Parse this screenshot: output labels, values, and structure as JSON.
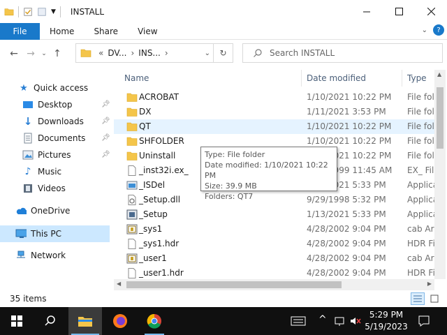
{
  "window": {
    "title": "INSTALL",
    "minimize_icon": "minimize-icon",
    "maximize_icon": "maximize-icon",
    "close_icon": "close-icon"
  },
  "ribbon": {
    "tabs": [
      "File",
      "Home",
      "Share",
      "View"
    ],
    "help_glyph": "?"
  },
  "address": {
    "overflow": "«",
    "crumbs": [
      "DV...",
      "INS..."
    ],
    "sep": "›",
    "search_placeholder": "Search INSTALL"
  },
  "nav": {
    "quick_access": "Quick access",
    "items": [
      {
        "label": "Desktop",
        "pinned": true
      },
      {
        "label": "Downloads",
        "pinned": true
      },
      {
        "label": "Documents",
        "pinned": true
      },
      {
        "label": "Pictures",
        "pinned": true
      },
      {
        "label": "Music",
        "pinned": false
      },
      {
        "label": "Videos",
        "pinned": false
      }
    ],
    "onedrive": "OneDrive",
    "this_pc": "This PC",
    "network": "Network"
  },
  "columns": {
    "name": "Name",
    "date": "Date modified",
    "type": "Type"
  },
  "files": [
    {
      "name": "ACROBAT",
      "date": "1/10/2021 10:22 PM",
      "type": "File folder",
      "icon": "folder-icon"
    },
    {
      "name": "DX",
      "date": "1/11/2021 3:53 PM",
      "type": "File folder",
      "icon": "folder-icon"
    },
    {
      "name": "QT",
      "date": "1/10/2021 10:22 PM",
      "type": "File folder",
      "icon": "folder-icon"
    },
    {
      "name": "SHFOLDER",
      "date": "1/10/2021 10:22 PM",
      "type": "File folder",
      "icon": "folder-icon"
    },
    {
      "name": "Uninstall",
      "date": "1/10/2021 10:22 PM",
      "type": "File folder",
      "icon": "folder-icon"
    },
    {
      "name": "_inst32i.ex_",
      "date": "9/29/1999 11:45 AM",
      "type": "EX_ File",
      "icon": "file-icon"
    },
    {
      "name": "_ISDel",
      "date": "1/13/2021 5:33 PM",
      "type": "Application",
      "icon": "app-icon"
    },
    {
      "name": "_Setup.dll",
      "date": "9/29/1998 5:32 PM",
      "type": "Application extension",
      "icon": "dll-icon"
    },
    {
      "name": "_Setup",
      "date": "1/13/2021 5:33 PM",
      "type": "Application",
      "icon": "setup-icon"
    },
    {
      "name": "_sys1",
      "date": "4/28/2002 9:04 PM",
      "type": "cab Archive",
      "icon": "cab-icon"
    },
    {
      "name": "_sys1.hdr",
      "date": "4/28/2002 9:04 PM",
      "type": "HDR File",
      "icon": "file-icon"
    },
    {
      "name": "_user1",
      "date": "4/28/2002 9:04 PM",
      "type": "cab Archive",
      "icon": "cab-icon"
    },
    {
      "name": "_user1.hdr",
      "date": "4/28/2002 9:04 PM",
      "type": "HDR File",
      "icon": "file-icon"
    }
  ],
  "tooltip": {
    "line1": "Type: File folder",
    "line2": "Date modified: 1/10/2021 10:22 PM",
    "line3": "Size: 39.9 MB",
    "line4": "Folders: QT7"
  },
  "status": {
    "count": "35 items"
  },
  "taskbar": {
    "time": "5:29 PM",
    "date": "5/19/2023"
  },
  "colors": {
    "accent": "#1979ca",
    "folder": "#f4c54a",
    "selection": "#cce8ff",
    "hover": "#e5f3ff",
    "taskbar": "#101010"
  }
}
